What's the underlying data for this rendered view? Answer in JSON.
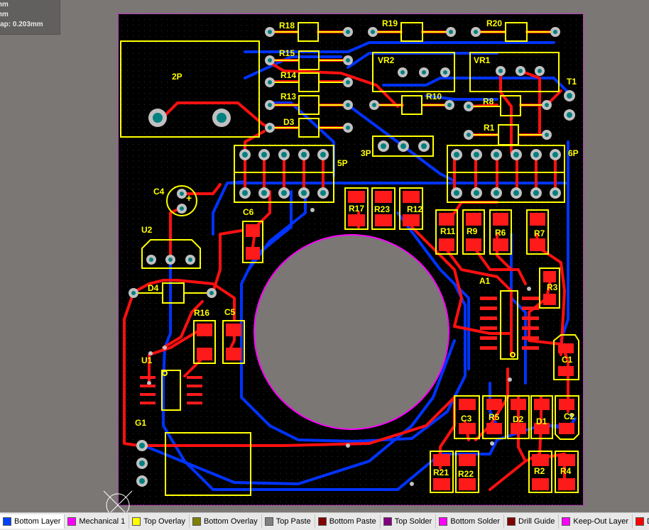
{
  "hud": {
    "line1": "mm",
    "line2": "mm",
    "line3": "nap: 0.203mm"
  },
  "designators": {
    "R18": "R18",
    "R19": "R19",
    "R20": "R20",
    "R15": "R15",
    "R14": "R14",
    "R13": "R13",
    "D3": "D3",
    "VR2": "VR2",
    "VR1": "VR1",
    "R10": "R10",
    "R8": "R8",
    "R1": "R1",
    "T1": "T1",
    "P2": "2P",
    "P5": "5P",
    "P3": "3P",
    "P6": "6P",
    "C4": "C4",
    "C4plus": "+",
    "C6": "C6",
    "R17": "R17",
    "R23": "R23",
    "R12": "R12",
    "R11": "R11",
    "R9": "R9",
    "R6": "R6",
    "R7": "R7",
    "U2": "U2",
    "D4": "D4",
    "R16": "R16",
    "C5": "C5",
    "U1": "U1",
    "A1": "A1",
    "R3": "R3",
    "C1": "C1",
    "G1": "G1",
    "C3": "C3",
    "R5": "R5",
    "D2": "D2",
    "D1": "D1",
    "C2": "C2",
    "R21": "R21",
    "R22": "R22",
    "R2": "R2",
    "R4": "R4"
  },
  "layers": [
    {
      "label": "Bottom Layer",
      "color": "#0040ff"
    },
    {
      "label": "Mechanical 1",
      "color": "#ff00ff"
    },
    {
      "label": "Top Overlay",
      "color": "#ffff00"
    },
    {
      "label": "Bottom Overlay",
      "color": "#808000"
    },
    {
      "label": "Top Paste",
      "color": "#808080"
    },
    {
      "label": "Bottom Paste",
      "color": "#800000"
    },
    {
      "label": "Top Solder",
      "color": "#800080"
    },
    {
      "label": "Bottom Solder",
      "color": "#ff00ff"
    },
    {
      "label": "Drill Guide",
      "color": "#800000"
    },
    {
      "label": "Keep-Out Layer",
      "color": "#ff00ff"
    },
    {
      "label": "D",
      "color": "#ff0000"
    }
  ],
  "colors": {
    "board": "#000000",
    "outline": "#ff00ff",
    "top": "#ff0000",
    "bottom": "#0033ff",
    "overlay": "#ffff00",
    "pad": "#c0c0c0",
    "hole": "#008080",
    "cutout": "#7a7775"
  }
}
